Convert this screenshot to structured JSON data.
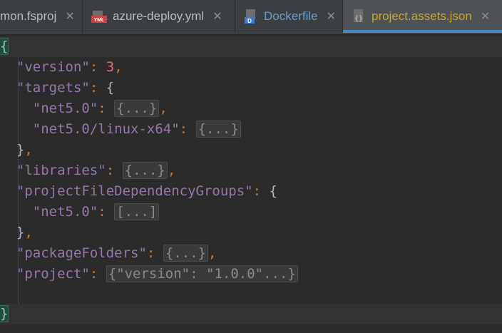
{
  "tabs": [
    {
      "label": "mon.fsproj",
      "icon": "fsproj-icon",
      "active": false
    },
    {
      "label": "azure-deploy.yml",
      "icon": "yml-file-icon",
      "badge": "YML",
      "active": false
    },
    {
      "label": "Dockerfile",
      "icon": "dockerfile-icon",
      "badge": "D",
      "active": false
    },
    {
      "label": "project.assets.json",
      "icon": "json-file-icon",
      "badge": "{}",
      "active": true
    }
  ],
  "close_glyph": "✕",
  "code": {
    "open_brace": "{",
    "close_brace": "}",
    "version_key": "\"version\"",
    "version_value": "3",
    "targets_key": "\"targets\"",
    "net50_key": "\"net5.0\"",
    "net50_fold": "{...}",
    "net50_linux_key": "\"net5.0/linux-x64\"",
    "net50_linux_fold": "{...}",
    "libraries_key": "\"libraries\"",
    "libraries_fold": "{...}",
    "groups_key": "\"projectFileDependencyGroups\"",
    "groups_net50_key": "\"net5.0\"",
    "groups_net50_fold": "[...]",
    "packageFolders_key": "\"packageFolders\"",
    "packageFolders_fold": "{...}",
    "project_key": "\"project\"",
    "project_fold": "{\"version\": \"1.0.0\"...}"
  }
}
